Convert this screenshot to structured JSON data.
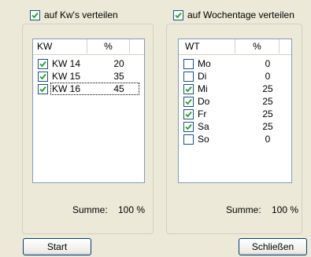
{
  "kw_panel": {
    "checkbox_label": "auf Kw's verteilen",
    "checkbox_checked": true,
    "columns": [
      "KW",
      "%"
    ],
    "rows": [
      {
        "label": "KW 14",
        "value": "20",
        "checked": true
      },
      {
        "label": "KW 15",
        "value": "35",
        "checked": true
      },
      {
        "label": "KW 16",
        "value": "45",
        "checked": true
      }
    ],
    "sum_label": "Summe:",
    "sum_value": "100 %"
  },
  "wt_panel": {
    "checkbox_label": "auf Wochentage verteilen",
    "checkbox_checked": true,
    "columns": [
      "WT",
      "%"
    ],
    "rows": [
      {
        "label": "Mo",
        "value": "0",
        "checked": false
      },
      {
        "label": "Di",
        "value": "0",
        "checked": false
      },
      {
        "label": "Mi",
        "value": "25",
        "checked": true
      },
      {
        "label": "Do",
        "value": "25",
        "checked": true
      },
      {
        "label": "Fr",
        "value": "25",
        "checked": true
      },
      {
        "label": "Sa",
        "value": "25",
        "checked": true
      },
      {
        "label": "So",
        "value": "0",
        "checked": false
      }
    ],
    "sum_label": "Summe:",
    "sum_value": "100 %"
  },
  "buttons": {
    "start_label": "Start",
    "close_label": "Schließen"
  },
  "colors": {
    "window_bg": "#ece9d8",
    "check_mark": "#21a121",
    "checkbox_border": "#1c5180",
    "list_border": "#7f9db9"
  }
}
